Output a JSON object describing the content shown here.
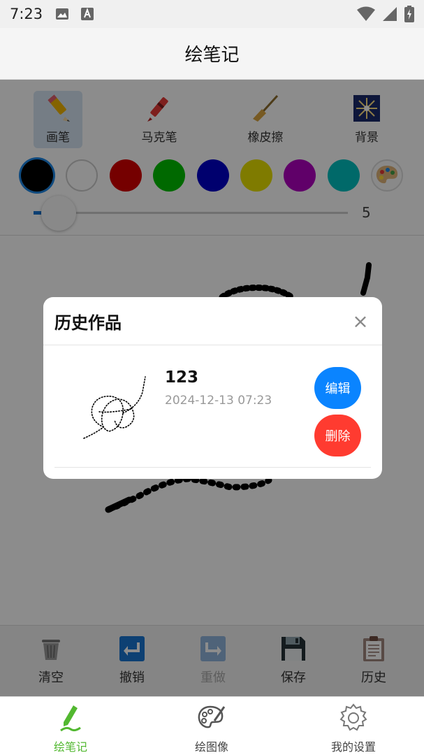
{
  "status": {
    "time": "7:23"
  },
  "header": {
    "title": "绘笔记"
  },
  "tools": [
    {
      "label": "画笔",
      "icon": "pencil-icon"
    },
    {
      "label": "马克笔",
      "icon": "crayon-icon"
    },
    {
      "label": "橡皮擦",
      "icon": "broom-icon"
    },
    {
      "label": "背景",
      "icon": "fireworks-icon"
    }
  ],
  "colors": [
    "#000000",
    "#ffffff",
    "#d50000",
    "#00c000",
    "#0000c8",
    "#e8e000",
    "#b000c0",
    "#00c0c0"
  ],
  "brush_size": "5",
  "actions": [
    {
      "label": "清空",
      "icon": "trash-icon"
    },
    {
      "label": "撤销",
      "icon": "undo-icon"
    },
    {
      "label": "重做",
      "icon": "redo-icon"
    },
    {
      "label": "保存",
      "icon": "floppy-icon"
    },
    {
      "label": "历史",
      "icon": "clipboard-icon"
    }
  ],
  "nav": [
    {
      "label": "绘笔记",
      "icon": "pen-icon"
    },
    {
      "label": "绘图像",
      "icon": "palette-icon"
    },
    {
      "label": "我的设置",
      "icon": "gear-icon"
    }
  ],
  "dialog": {
    "title": "历史作品",
    "close": "×",
    "item": {
      "name": "123",
      "date": "2024-12-13 07:23",
      "edit_label": "编辑",
      "delete_label": "删除"
    }
  },
  "accent": "#52b830"
}
